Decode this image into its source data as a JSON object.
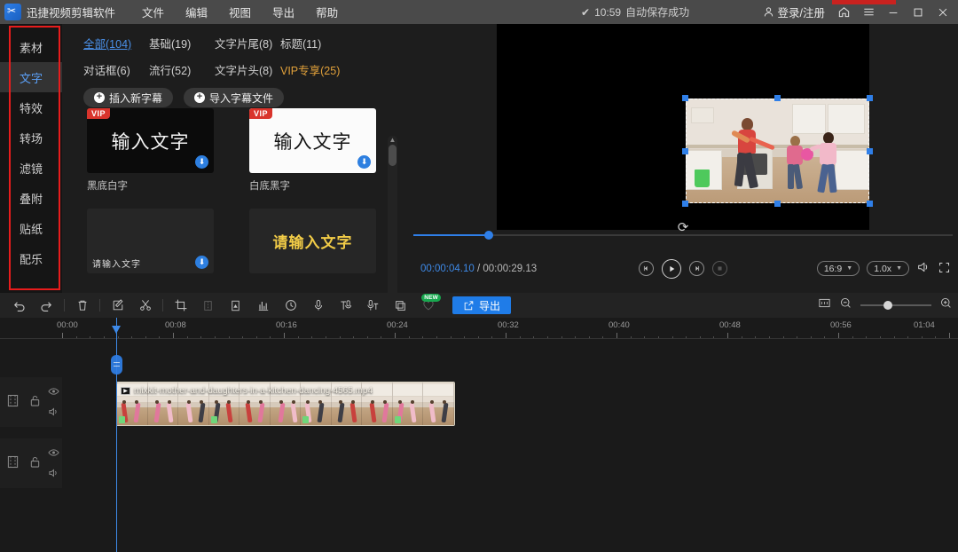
{
  "titlebar": {
    "app_name": "迅捷视频剪辑软件",
    "logo_icon": "scissors-logo-icon",
    "menus": [
      "文件",
      "编辑",
      "视图",
      "导出",
      "帮助"
    ],
    "check_icon": "check-icon",
    "time": "10:59",
    "autosave": "自动保存成功",
    "user_icon": "user-icon",
    "login": "登录/注册",
    "home_icon": "home-icon",
    "menu_icon": "hamburger-icon",
    "minimize_icon": "minimize-icon",
    "maximize_icon": "maximize-icon",
    "close_icon": "close-icon"
  },
  "sidebar": {
    "items": [
      {
        "label": "素材",
        "active": false
      },
      {
        "label": "文字",
        "active": true
      },
      {
        "label": "特效",
        "active": false
      },
      {
        "label": "转场",
        "active": false
      },
      {
        "label": "滤镜",
        "active": false
      },
      {
        "label": "叠附",
        "active": false
      },
      {
        "label": "贴纸",
        "active": false
      },
      {
        "label": "配乐",
        "active": false
      }
    ],
    "highlight_color": "#e81c1c"
  },
  "panel": {
    "tabs_row1": [
      {
        "label": "全部(104)",
        "state": "active"
      },
      {
        "label": "基础(19)",
        "state": "normal"
      },
      {
        "label": "文字片尾(8)",
        "state": "normal"
      },
      {
        "label": "标题(11)",
        "state": "normal"
      }
    ],
    "tabs_row2": [
      {
        "label": "对话框(6)",
        "state": "normal"
      },
      {
        "label": "流行(52)",
        "state": "normal"
      },
      {
        "label": "文字片头(8)",
        "state": "normal"
      },
      {
        "label": "VIP专享(25)",
        "state": "vip"
      }
    ],
    "actions": [
      {
        "label": "插入新字幕",
        "icon": "plus-circle-icon"
      },
      {
        "label": "导入字幕文件",
        "icon": "plus-circle-icon"
      }
    ],
    "templates_row1": [
      {
        "preview_text": "输入文字",
        "caption": "黑底白字",
        "vip": "VIP",
        "style": "dark",
        "download_icon": "download-icon"
      },
      {
        "preview_text": "输入文字",
        "caption": "白底黑字",
        "vip": "VIP",
        "style": "light",
        "download_icon": "download-icon"
      }
    ],
    "templates_row2": [
      {
        "preview_text": "请输入文字",
        "caption": "",
        "style": "small",
        "download_icon": "download-icon"
      },
      {
        "preview_text": "请输入文字",
        "caption": "",
        "style": "yellow"
      }
    ],
    "scrollbar": {
      "up_icon": "scroll-up-icon",
      "down_icon": "scroll-down-icon"
    }
  },
  "preview": {
    "current_time": "00:00:04.10",
    "separator": " / ",
    "total_time": "00:00:29.13",
    "controls": [
      {
        "name": "prev-frame-button",
        "glyph": "◀|"
      },
      {
        "name": "play-button",
        "glyph": "▶"
      },
      {
        "name": "next-frame-button",
        "glyph": "|▶"
      },
      {
        "name": "stop-button",
        "glyph": "■"
      }
    ],
    "aspect_ratio": "16:9",
    "speed": "1.0x",
    "volume_icon": "volume-icon",
    "fullscreen_icon": "fullscreen-icon",
    "rotate_icon": "rotate-icon",
    "progress_percent": 14
  },
  "toolbar": {
    "tools": [
      {
        "name": "undo-icon",
        "label": "撤销"
      },
      {
        "name": "redo-icon",
        "label": "重做"
      },
      {
        "name": "delete-icon",
        "label": "删除"
      },
      {
        "name": "edit-icon",
        "label": "编辑"
      },
      {
        "name": "cut-icon",
        "label": "裁剪"
      },
      {
        "name": "crop-icon",
        "label": "画面裁剪"
      },
      {
        "name": "split-icon",
        "label": "分割"
      },
      {
        "name": "mask-icon",
        "label": "蒙版"
      },
      {
        "name": "audio-wave-icon",
        "label": "音频"
      },
      {
        "name": "duration-icon",
        "label": "时长"
      },
      {
        "name": "mic-icon",
        "label": "录音"
      },
      {
        "name": "text-to-speech-icon",
        "label": "文字转语音"
      },
      {
        "name": "speech-to-text-icon",
        "label": "语音转文字"
      },
      {
        "name": "copy-icon",
        "label": "复制"
      },
      {
        "name": "favorite-icon",
        "label": "收藏",
        "badge": "NEW"
      }
    ],
    "export_label": "导出",
    "export_icon": "export-icon",
    "export_color": "#1f7ce8",
    "fit-icon": "fit-timeline-icon",
    "zoom_out_icon": "zoom-out-icon",
    "zoom_in_icon": "zoom-in-icon"
  },
  "timeline": {
    "ruler_labels": [
      "00:00",
      "00:08",
      "00:16",
      "00:24",
      "00:32",
      "00:40",
      "00:48",
      "00:56",
      "01:04"
    ],
    "tracks": [
      {
        "film_icon": "film-strip-icon",
        "lock_icon": "lock-icon",
        "eye_icon": "eye-icon",
        "speaker_icon": "speaker-icon"
      },
      {
        "film_icon": "film-strip-icon",
        "lock_icon": "lock-icon",
        "eye_icon": "eye-icon",
        "speaker_icon": "speaker-icon"
      }
    ],
    "clip": {
      "name": "mixkit-mother-and-daughters-in-a-kitchen-dancing-4565.mp4",
      "type_icon": "video-clip-icon"
    },
    "playhead_color": "#3e8ae8"
  }
}
